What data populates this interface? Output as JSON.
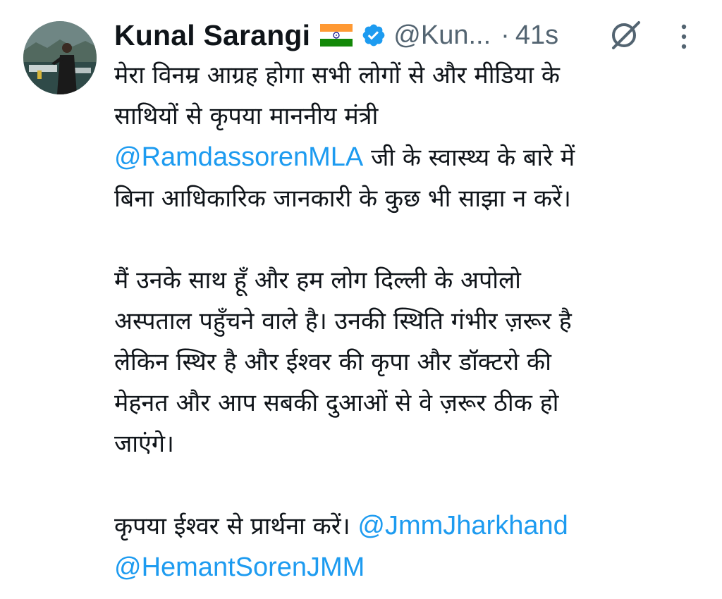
{
  "tweet": {
    "author": {
      "display_name": "Kunal Sarangi",
      "flag_icon": "india-flag-icon",
      "verified_icon": "verified-badge-icon",
      "handle": "@Kun...",
      "avatar_icon": "avatar"
    },
    "separator": "·",
    "time": "41s",
    "grok_icon": "grok-icon",
    "more_icon": "more-options-icon",
    "body": {
      "p1": {
        "line1": "मेरा विनम्र आग्रह होगा सभी लोगों से और मीडिया के",
        "line2": "साथियों से कृपया माननीय मंत्री",
        "mention1": "@RamdassorenMLA",
        "line3_rest": " जी के स्वास्थ्य के बारे में",
        "line4": "बिना आधिकारिक जानकारी के कुछ भी साझा न करें।"
      },
      "p2": {
        "line1": "मैं उनके साथ हूँ और हम लोग दिल्ली के अपोलो",
        "line2": "अस्पताल पहुँचने वाले है। उनकी स्थिति गंभीर ज़रूर है",
        "line3": "लेकिन स्थिर है और ईश्वर की कृपा और डॉक्टरो की",
        "line4": "मेहनत और आप सबकी दुआओं से वे ज़रूर ठीक हो",
        "line5": "जाएंगे।"
      },
      "p3": {
        "line1": "कृपया ईश्वर से प्रार्थना करें। ",
        "mention1": "@JmmJharkhand",
        "mention2": "@HemantSorenJMM"
      }
    }
  },
  "colors": {
    "text": "#0f1419",
    "muted": "#536471",
    "link": "#1d9bf0"
  }
}
